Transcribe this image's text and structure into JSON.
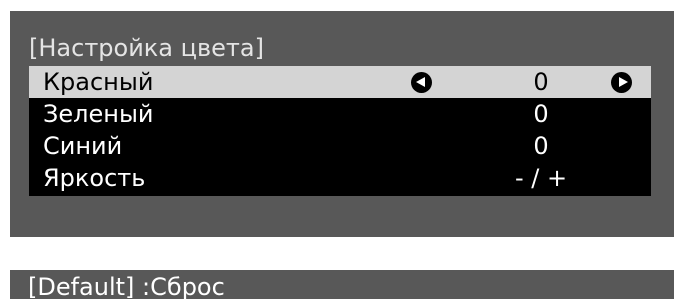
{
  "panel": {
    "title": "[Настройка цвета]",
    "rows": [
      {
        "label": "Красный",
        "value": "0"
      },
      {
        "label": "Зеленый",
        "value": "0"
      },
      {
        "label": "Синий",
        "value": "0"
      },
      {
        "label": "Яркость",
        "value": "- / +"
      }
    ],
    "left_arrow_icon": "left-arrow-circle-icon",
    "right_arrow_icon": "right-arrow-circle-icon"
  },
  "footer": {
    "hint": "[Default]  :Сброс"
  },
  "colors": {
    "panel_background": "#585858",
    "menu_background": "#000000",
    "selected_row_background": "#d4d4d4",
    "title_text": "#e4e4e4"
  }
}
